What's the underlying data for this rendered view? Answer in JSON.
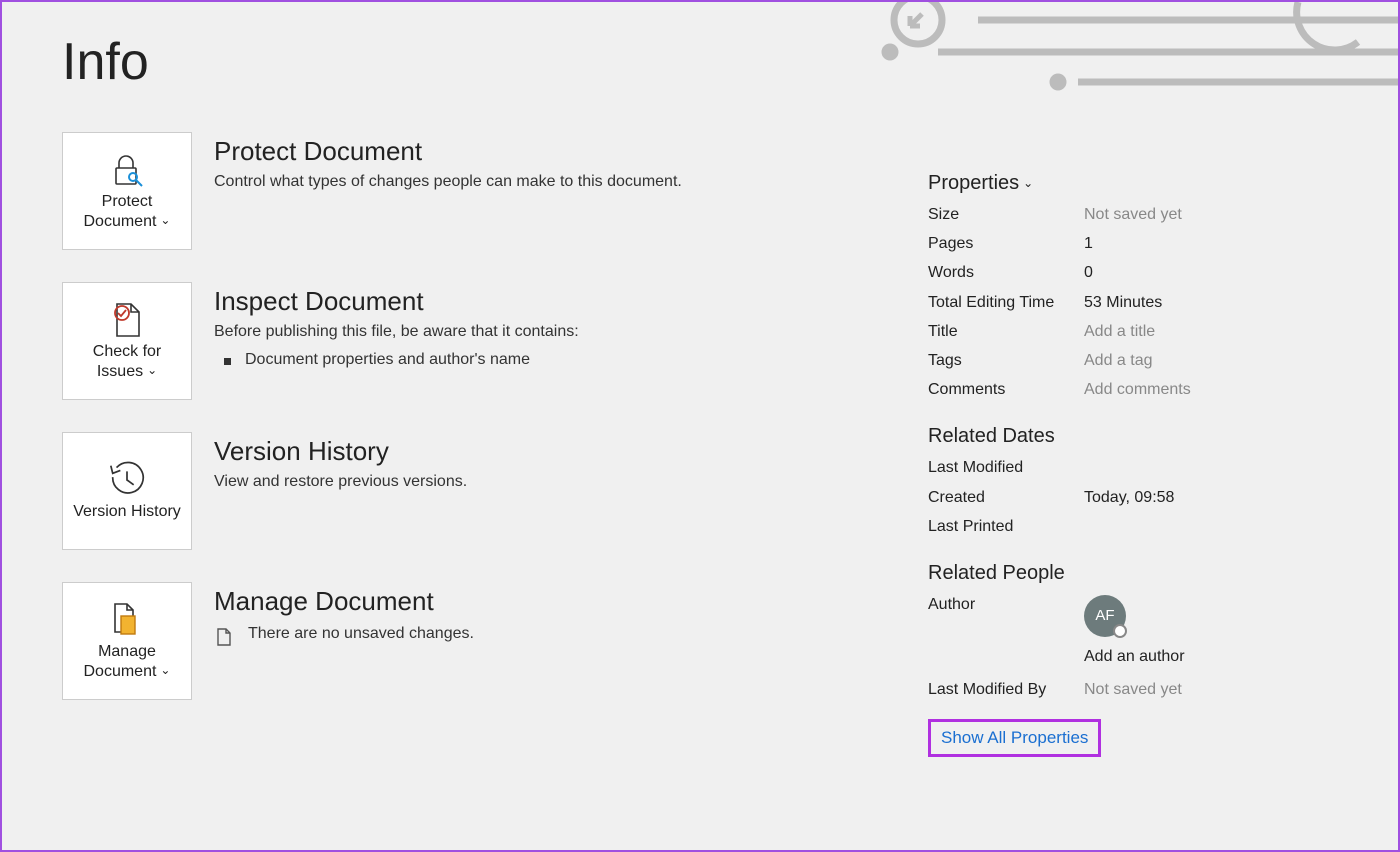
{
  "page": {
    "title": "Info"
  },
  "sections": {
    "protect": {
      "tile_label": "Protect Document",
      "title": "Protect Document",
      "desc": "Control what types of changes people can make to this document."
    },
    "inspect": {
      "tile_label": "Check for Issues",
      "title": "Inspect Document",
      "desc": "Before publishing this file, be aware that it contains:",
      "bullet": "Document properties and author's name"
    },
    "versions": {
      "tile_label": "Version History",
      "title": "Version History",
      "desc": "View and restore previous versions."
    },
    "manage": {
      "tile_label": "Manage Document",
      "title": "Manage Document",
      "desc": "There are no unsaved changes."
    }
  },
  "props": {
    "header": "Properties",
    "rows": {
      "size": {
        "k": "Size",
        "v": "Not saved yet",
        "muted": true
      },
      "pages": {
        "k": "Pages",
        "v": "1"
      },
      "words": {
        "k": "Words",
        "v": "0"
      },
      "tet": {
        "k": "Total Editing Time",
        "v": "53 Minutes"
      },
      "title": {
        "k": "Title",
        "v": "Add a title",
        "muted": true
      },
      "tags": {
        "k": "Tags",
        "v": "Add a tag",
        "muted": true
      },
      "comm": {
        "k": "Comments",
        "v": "Add comments",
        "muted": true
      }
    }
  },
  "dates": {
    "header": "Related Dates",
    "rows": {
      "modified": {
        "k": "Last Modified",
        "v": ""
      },
      "created": {
        "k": "Created",
        "v": "Today, 09:58"
      },
      "printed": {
        "k": "Last Printed",
        "v": ""
      }
    }
  },
  "people": {
    "header": "Related People",
    "author_label": "Author",
    "author_initials": "AF",
    "add_author": "Add an author",
    "lmb_label": "Last Modified By",
    "lmb_value": "Not saved yet"
  },
  "show_all": "Show All Properties"
}
